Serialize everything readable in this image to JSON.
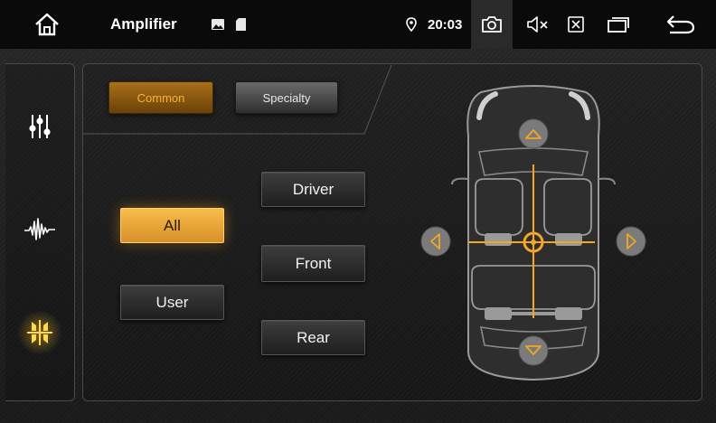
{
  "status_bar": {
    "app_title": "Amplifier",
    "time": "20:03",
    "icons": [
      "home-icon",
      "image-icon",
      "sd-card-icon",
      "location-pin-icon",
      "camera-icon",
      "mute-icon",
      "close-box-icon",
      "recent-apps-icon",
      "back-icon"
    ]
  },
  "sidebar": {
    "items": [
      {
        "name": "equalizer-icon",
        "active": false
      },
      {
        "name": "waveform-icon",
        "active": false
      },
      {
        "name": "balance-fader-icon",
        "active": true
      }
    ]
  },
  "tabs": {
    "common_label": "Common",
    "specialty_label": "Specialty",
    "selected": "Common"
  },
  "listening_position": {
    "all_label": "All",
    "user_label": "User",
    "driver_label": "Driver",
    "front_label": "Front",
    "rear_label": "Rear",
    "selected": "All"
  },
  "car_diagram": {
    "arrows": [
      "up-arrow-icon",
      "down-arrow-icon",
      "left-arrow-icon",
      "right-arrow-icon"
    ],
    "accent_color": "#f5a623"
  },
  "colors": {
    "accent": "#f5a623",
    "background": "#1c1c1c",
    "statusbar": "#0a0a0a"
  }
}
